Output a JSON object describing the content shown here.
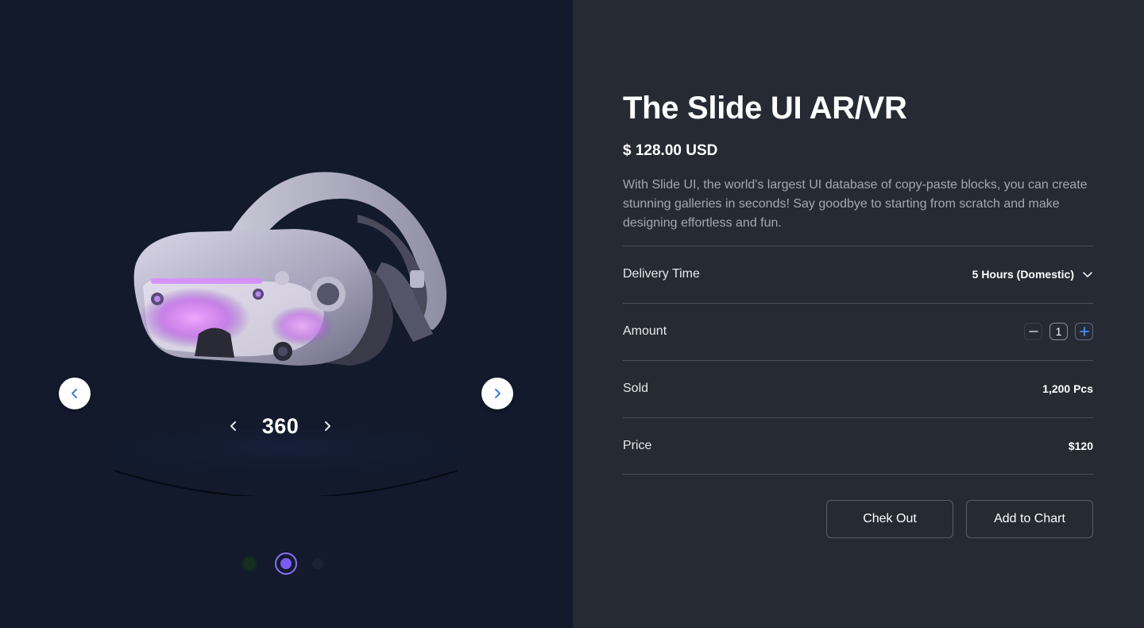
{
  "gallery": {
    "rotation_value": "360",
    "active_slide": 2,
    "slide_count": 3,
    "colors": {
      "dot_active": "#7b5cf0",
      "dot_green": "#14301f"
    }
  },
  "product": {
    "title": "The Slide UI AR/VR",
    "price": "$ 128.00 USD",
    "description": "With Slide UI, the world's largest UI database of copy-paste blocks, you can create stunning galleries in seconds! Say goodbye to starting from scratch and make designing effortless and fun."
  },
  "details": {
    "delivery": {
      "label": "Delivery Time",
      "value": "5 Hours (Domestic)"
    },
    "amount": {
      "label": "Amount",
      "value": "1"
    },
    "sold": {
      "label": "Sold",
      "value": "1,200 Pcs"
    },
    "price": {
      "label": "Price",
      "value": "$120"
    }
  },
  "actions": {
    "checkout_label": "Chek Out",
    "add_label": "Add to Chart"
  },
  "icons": {
    "prev": "chevron-left-icon",
    "next": "chevron-right-icon",
    "dropdown": "chevron-down-icon",
    "minus": "minus-icon",
    "plus": "plus-icon"
  }
}
